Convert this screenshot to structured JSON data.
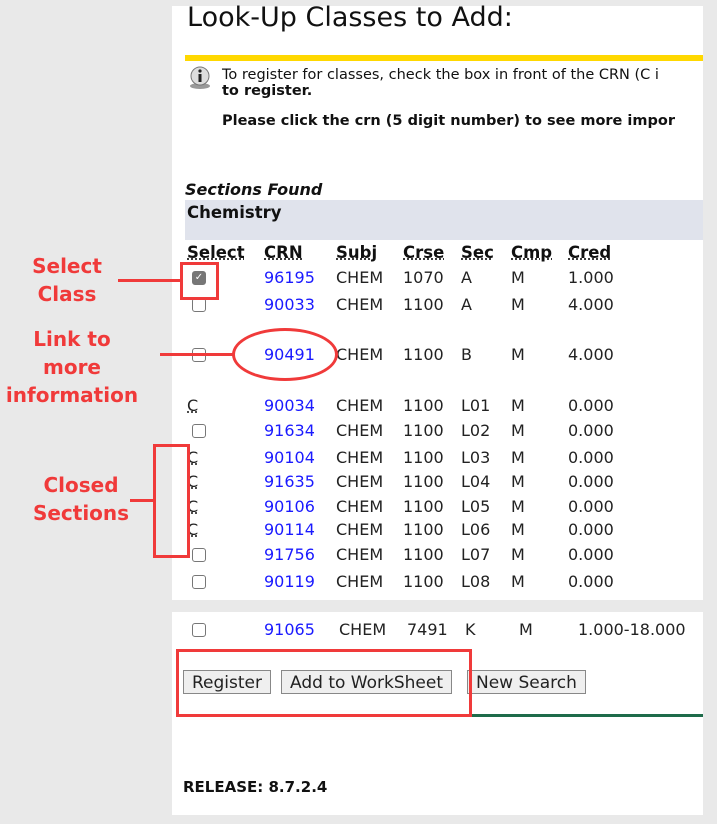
{
  "page_title": "Look-Up Classes to Add:",
  "info": {
    "line1": "To register for classes, check the box in front of the CRN (C i",
    "line2": "to register.",
    "line3": "Please click the crn (5 digit number) to see more impor"
  },
  "sections_found": "Sections Found",
  "subject": "Chemistry",
  "columns": [
    "Select",
    "CRN",
    "Subj",
    "Crse",
    "Sec",
    "Cmp",
    "Cred"
  ],
  "rows": [
    {
      "select": "checked",
      "crn": "96195",
      "subj": "CHEM",
      "crse": "1070",
      "sec": "A",
      "cmp": "M",
      "cred": "1.000"
    },
    {
      "select": "checkbox",
      "crn": "90033",
      "subj": "CHEM",
      "crse": "1100",
      "sec": "A",
      "cmp": "M",
      "cred": "4.000"
    },
    {
      "select": "checkbox",
      "crn": "90491",
      "subj": "CHEM",
      "crse": "1100",
      "sec": "B",
      "cmp": "M",
      "cred": "4.000"
    },
    {
      "select": "C",
      "crn": "90034",
      "subj": "CHEM",
      "crse": "1100",
      "sec": "L01",
      "cmp": "M",
      "cred": "0.000"
    },
    {
      "select": "checkbox",
      "crn": "91634",
      "subj": "CHEM",
      "crse": "1100",
      "sec": "L02",
      "cmp": "M",
      "cred": "0.000"
    },
    {
      "select": "C",
      "crn": "90104",
      "subj": "CHEM",
      "crse": "1100",
      "sec": "L03",
      "cmp": "M",
      "cred": "0.000"
    },
    {
      "select": "C",
      "crn": "91635",
      "subj": "CHEM",
      "crse": "1100",
      "sec": "L04",
      "cmp": "M",
      "cred": "0.000"
    },
    {
      "select": "C",
      "crn": "90106",
      "subj": "CHEM",
      "crse": "1100",
      "sec": "L05",
      "cmp": "M",
      "cred": "0.000"
    },
    {
      "select": "C",
      "crn": "90114",
      "subj": "CHEM",
      "crse": "1100",
      "sec": "L06",
      "cmp": "M",
      "cred": "0.000"
    },
    {
      "select": "checkbox",
      "crn": "91756",
      "subj": "CHEM",
      "crse": "1100",
      "sec": "L07",
      "cmp": "M",
      "cred": "0.000"
    },
    {
      "select": "checkbox",
      "crn": "90119",
      "subj": "CHEM",
      "crse": "1100",
      "sec": "L08",
      "cmp": "M",
      "cred": "0.000"
    }
  ],
  "extra_row": {
    "select": "checkbox",
    "crn": "91065",
    "subj": "CHEM",
    "crse": "7491",
    "sec": "K",
    "cmp": "M",
    "cred": "1.000-18.000"
  },
  "buttons": {
    "register": "Register",
    "worksheet": "Add to WorkSheet",
    "new_search": "New Search"
  },
  "release": "RELEASE: 8.7.2.4",
  "annotations": {
    "select_class": [
      "Select",
      "Class"
    ],
    "link_info": [
      "Link to more",
      "information"
    ],
    "closed": [
      "Closed",
      "Sections"
    ]
  },
  "colors": {
    "annotation": "#f03a3a",
    "link": "#1a1aff",
    "yellow_bar": "#ffd800",
    "green_bar": "#1e6b4a"
  }
}
